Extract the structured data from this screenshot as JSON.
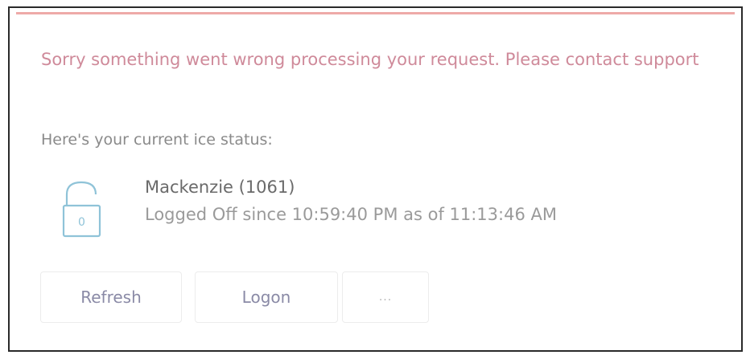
{
  "alert": {
    "message": "Sorry something went wrong processing your request. Please contact support"
  },
  "status": {
    "intro": "Here's your current ice status:",
    "icon": "padlock-unlocked-icon",
    "lock_label": "0",
    "user_name": "Mackenzie (1061)",
    "status_line": "Logged Off since 10:59:40 PM as of 11:13:46 AM"
  },
  "actions": {
    "refresh_label": "Refresh",
    "logon_label": "Logon",
    "more_label": "..."
  },
  "colors": {
    "accent_line": "#eeaaa8",
    "error_text": "#cf8a9a",
    "icon_stroke": "#8fc3d8"
  }
}
